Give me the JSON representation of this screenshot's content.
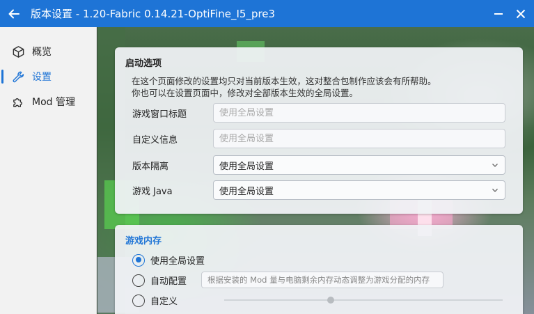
{
  "window": {
    "title": "版本设置 - 1.20-Fabric 0.14.21-OptiFine_I5_pre3",
    "back_icon": "arrow-left-icon",
    "minimize_icon": "minimize-icon",
    "close_icon": "close-icon"
  },
  "sidebar": {
    "items": [
      {
        "label": "概览",
        "icon": "box-icon",
        "active": false
      },
      {
        "label": "设置",
        "icon": "wrench-icon",
        "active": true
      },
      {
        "label": "Mod 管理",
        "icon": "puzzle-icon",
        "active": false
      }
    ]
  },
  "launch_options": {
    "title": "启动选项",
    "desc_line1": "在这个页面修改的设置均只对当前版本生效，这对整合包制作应该会有所帮助。",
    "desc_line2": "你也可以在设置页面中，修改对全部版本生效的全局设置。",
    "window_title": {
      "label": "游戏窗口标题",
      "value": "",
      "placeholder": "使用全局设置"
    },
    "custom_info": {
      "label": "自定义信息",
      "value": "",
      "placeholder": "使用全局设置"
    },
    "isolation": {
      "label": "版本隔离",
      "selected": "使用全局设置"
    },
    "java": {
      "label": "游戏 Java",
      "selected": "使用全局设置"
    }
  },
  "memory": {
    "title": "游戏内存",
    "options": [
      {
        "label": "使用全局设置",
        "checked": true
      },
      {
        "label": "自动配置",
        "checked": false
      },
      {
        "label": "自定义",
        "checked": false
      }
    ],
    "auto_hint": "根据安装的 Mod 量与电脑剩余内存动态调整为游戏分配的内存",
    "custom_slider_fraction": 0.39
  },
  "colors": {
    "accent": "#1e74d6"
  }
}
